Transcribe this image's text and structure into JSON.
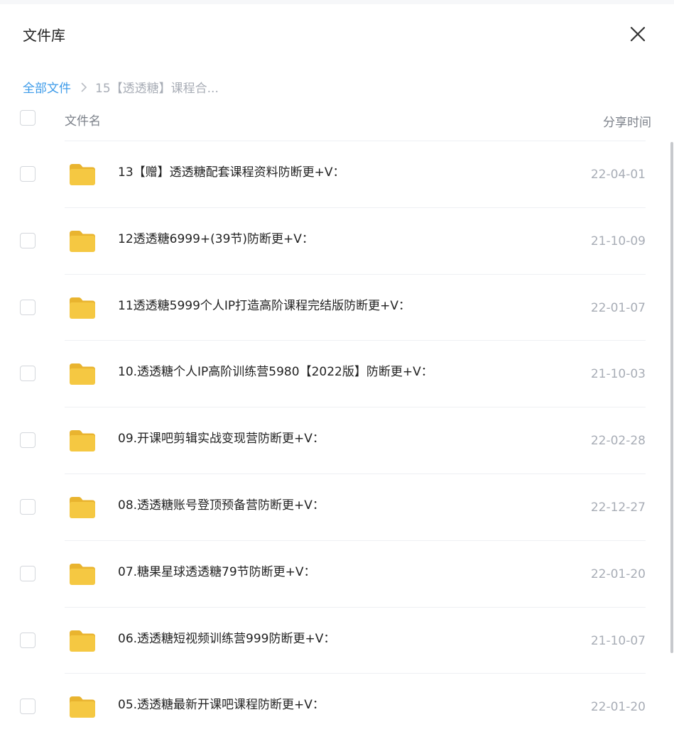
{
  "header": {
    "title": "文件库",
    "close_icon": "close-icon"
  },
  "breadcrumb": {
    "root": "全部文件",
    "separator_icon": "chevron-right-icon",
    "current": "15【透透糖】课程合..."
  },
  "columns": {
    "name": "文件名",
    "time": "分享时间"
  },
  "colors": {
    "accent": "#3d9be9",
    "folder": "#f5c842",
    "text": "#222222",
    "muted": "#a8adb6"
  },
  "files": [
    {
      "name": "13【赠】透透糖配套课程资料防断更+V：",
      "date": "22-04-01",
      "icon": "folder-icon"
    },
    {
      "name": "12透透糖6999+(39节)防断更+V：",
      "date": "21-10-09",
      "icon": "folder-icon"
    },
    {
      "name": "11透透糖5999个人IP打造高阶课程完结版防断更+V：",
      "date": "22-01-07",
      "icon": "folder-icon"
    },
    {
      "name": "10.透透糖个人IP高阶训练营5980【2022版】防断更+V：",
      "date": "21-10-03",
      "icon": "folder-icon"
    },
    {
      "name": "09.开课吧剪辑实战变现营防断更+V：",
      "date": "22-02-28",
      "icon": "folder-icon"
    },
    {
      "name": "08.透透糖账号登顶预备营防断更+V：",
      "date": "22-12-27",
      "icon": "folder-icon"
    },
    {
      "name": "07.糖果星球透透糖79节防断更+V：",
      "date": "22-01-20",
      "icon": "folder-icon"
    },
    {
      "name": "06.透透糖短视频训练营999防断更+V：",
      "date": "21-10-07",
      "icon": "folder-icon"
    },
    {
      "name": "05.透透糖最新开课吧课程防断更+V：",
      "date": "22-01-20",
      "icon": "folder-icon"
    }
  ]
}
